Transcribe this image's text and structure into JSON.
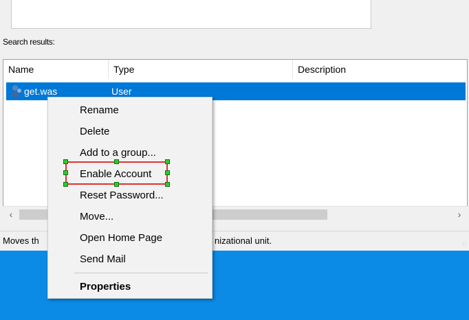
{
  "search_label": "Search results:",
  "columns": {
    "name": "Name",
    "type": "Type",
    "description": "Description"
  },
  "row": {
    "name": "get.was",
    "type": "User",
    "description": ""
  },
  "status_left": "Moves th",
  "status_right": "nizational unit.",
  "menu": {
    "rename": "Rename",
    "delete": "Delete",
    "add_group": "Add to a group...",
    "enable": "Enable Account",
    "reset": "Reset Password...",
    "move": "Move...",
    "home": "Open Home Page",
    "mail": "Send Mail",
    "properties": "Properties"
  },
  "colors": {
    "selection": "#0078d7",
    "desktop": "#0b8ae6",
    "highlight_border": "#e03030",
    "handle": "#2ecc2e"
  }
}
